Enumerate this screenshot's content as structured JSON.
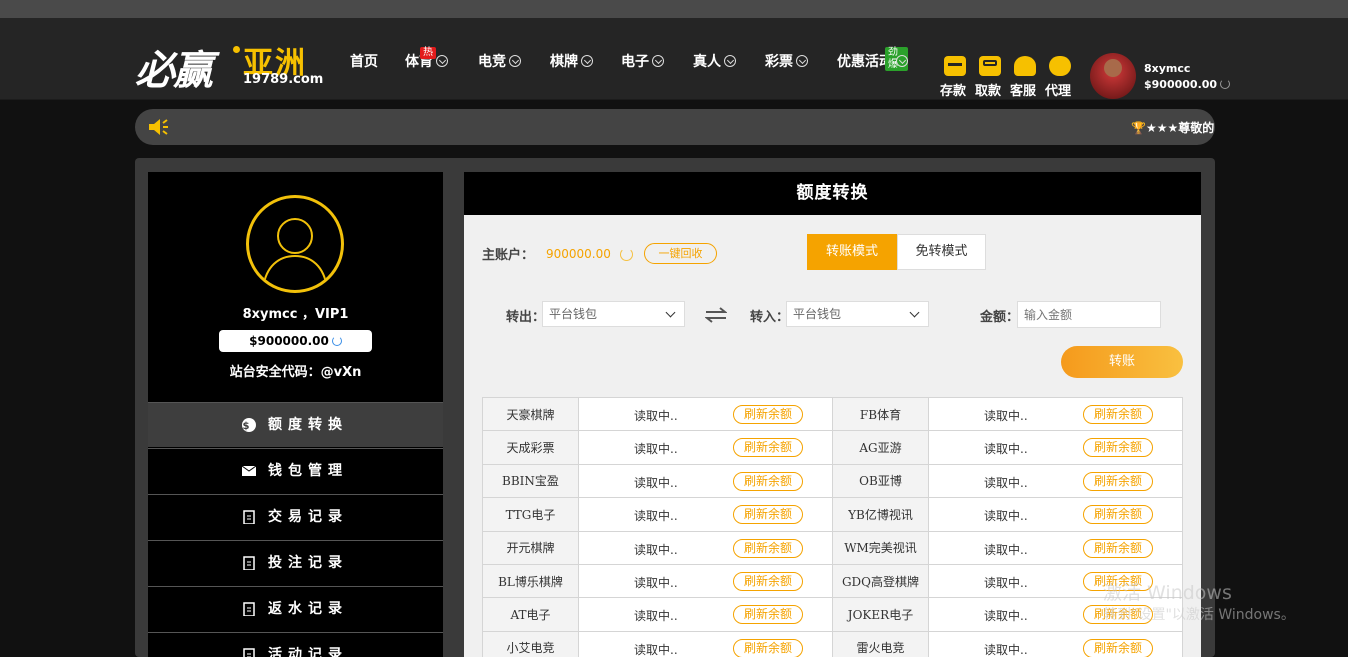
{
  "logo": {
    "brand_mark": "必赢",
    "brand_cn": "亚洲",
    "domain": "19789.com"
  },
  "nav": [
    {
      "label": "首页",
      "badge": ""
    },
    {
      "label": "体育",
      "badge": "热"
    },
    {
      "label": "电竞",
      "badge": ""
    },
    {
      "label": "棋牌",
      "badge": ""
    },
    {
      "label": "电子",
      "badge": ""
    },
    {
      "label": "真人",
      "badge": ""
    },
    {
      "label": "彩票",
      "badge": ""
    },
    {
      "label": "优惠活动",
      "badge": "劲爆"
    }
  ],
  "quick_actions": [
    {
      "label": "存款",
      "icon": "wallet-icon"
    },
    {
      "label": "取款",
      "icon": "atm-icon"
    },
    {
      "label": "客服",
      "icon": "headset-icon"
    },
    {
      "label": "代理",
      "icon": "handshake-icon"
    }
  ],
  "user": {
    "name": "8xymcc",
    "balance": "$900000.00"
  },
  "marquee": {
    "text": "🏆★★★尊敬的"
  },
  "sidebar": {
    "username": "8xymcc ，VIP1",
    "balance": "$900000.00",
    "security_code": "站台安全代码：@vXn",
    "menu": [
      {
        "label": "额度转换",
        "icon": "dollar-icon",
        "active": true
      },
      {
        "label": "钱包管理",
        "icon": "envelope-icon",
        "active": false
      },
      {
        "label": "交易记录",
        "icon": "clipboard-icon",
        "active": false
      },
      {
        "label": "投注记录",
        "icon": "clipboard-icon",
        "active": false
      },
      {
        "label": "返水记录",
        "icon": "clipboard-icon",
        "active": false
      },
      {
        "label": "活动记录",
        "icon": "clipboard-icon",
        "active": false
      }
    ]
  },
  "transfer": {
    "title": "额度转换",
    "main_account_label": "主账户：",
    "main_account_value": "900000.00",
    "recycle_button": "一键回收",
    "mode_transfer": "转账模式",
    "mode_free": "免转模式",
    "out_label": "转出：",
    "out_value": "平台钱包",
    "in_label": "转入：",
    "in_value": "平台钱包",
    "amount_label": "金额：",
    "amount_placeholder": "输入金额",
    "submit": "转账",
    "loading_text": "读取中..",
    "refresh_label": "刷新余额",
    "platforms": [
      [
        "天豪棋牌",
        "FB体育"
      ],
      [
        "天成彩票",
        "AG亚游"
      ],
      [
        "BBIN宝盈",
        "OB亚博"
      ],
      [
        "TTG电子",
        "YB亿博视讯"
      ],
      [
        "开元棋牌",
        "WM完美视讯"
      ],
      [
        "BL博乐棋牌",
        "GDQ高登棋牌"
      ],
      [
        "AT电子",
        "JOKER电子"
      ],
      [
        "小艾电竞",
        "雷火电竞"
      ]
    ]
  },
  "watermark": {
    "line1": "激活 Windows",
    "line2": "转到\"设置\"以激活 Windows。"
  },
  "colors": {
    "accent": "#f6c000",
    "orange": "#f5a300",
    "dark": "#000000"
  }
}
